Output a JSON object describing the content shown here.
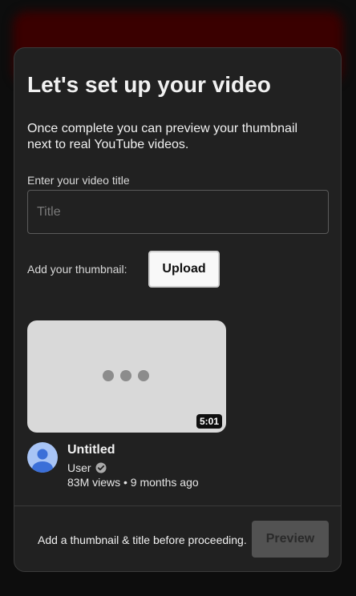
{
  "dialog": {
    "title": "Let's set up your video",
    "subtitle": "Once complete you can preview your thumbnail next to real YouTube videos."
  },
  "title_field": {
    "label": "Enter your video title",
    "placeholder": "Title",
    "value": ""
  },
  "thumbnail_field": {
    "label": "Add your thumbnail:",
    "upload_label": "Upload"
  },
  "video_preview": {
    "duration": "5:01",
    "title": "Untitled",
    "channel": "User",
    "meta": "83M views • 9 months ago"
  },
  "footer": {
    "hint": "Add a thumbnail & title before proceeding.",
    "preview_label": "Preview"
  },
  "colors": {
    "dialog_background": "#212121",
    "avatar_background": "#a8c4f5",
    "avatar_figure": "#3b6fd8",
    "thumbnail_placeholder": "#d9d9d9",
    "disabled_button": "#525252"
  },
  "icons": {
    "loading": "three-dots-icon",
    "avatar": "user-avatar-icon",
    "verified": "verified-check-icon"
  }
}
